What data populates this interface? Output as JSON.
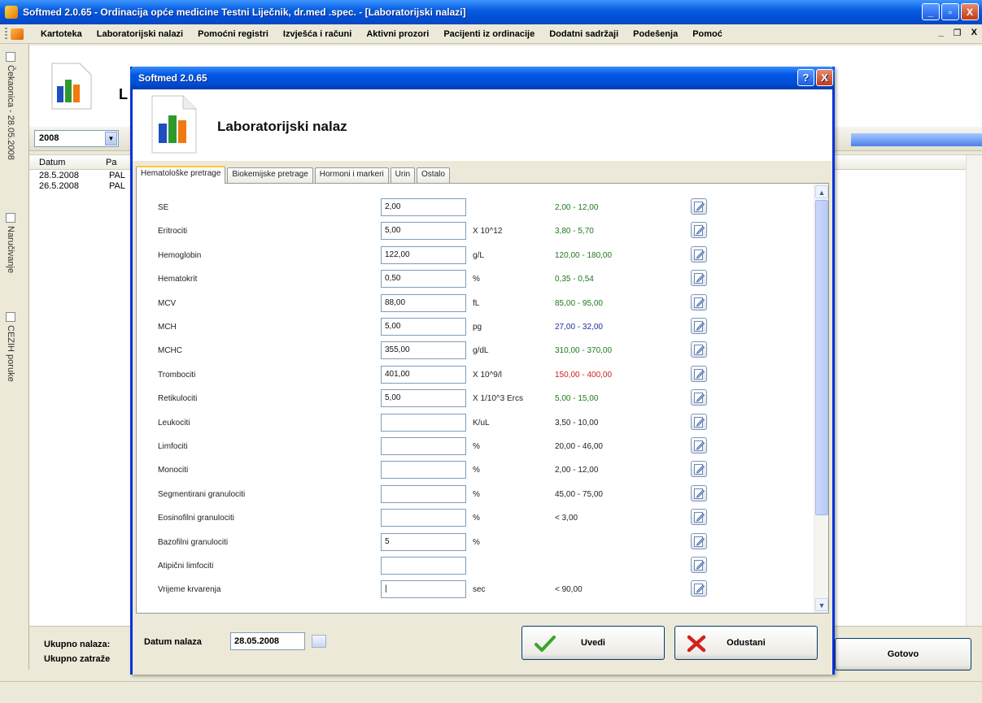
{
  "app": {
    "title": "Softmed 2.0.65 - Ordinacija opće medicine Testni Liječnik, dr.med .spec. - [Laboratorijski nalazi]",
    "window_buttons": {
      "minimize": "_",
      "maximize": "▫",
      "close": "X"
    }
  },
  "menu": {
    "items": [
      "Kartoteka",
      "Laboratorijski nalazi",
      "Pomoćni registri",
      "Izvješća i računi",
      "Aktivni prozori",
      "Pacijenti iz ordinacije",
      "Dodatni sadržaji",
      "Podešenja",
      "Pomoć"
    ],
    "mdi_buttons": {
      "minimize": "_",
      "restore": "❐",
      "close": "X"
    }
  },
  "left_strip": {
    "tabs": [
      "Čekaonica - 28.05.2008",
      "Naručivanje",
      "CEZIH poruke"
    ]
  },
  "background": {
    "header_text": "L",
    "year": "2008",
    "list_columns": [
      "Datum",
      "Pa"
    ],
    "rows": [
      {
        "datum": "28.5.2008",
        "pa": "PAL"
      },
      {
        "datum": "26.5.2008",
        "pa": "PAL"
      }
    ],
    "footer": {
      "label1": "Ukupno nalaza:",
      "label2": "Ukupno zatraže",
      "gotovo": "Gotovo"
    }
  },
  "dialog": {
    "title": "Softmed 2.0.65",
    "help_btn": "?",
    "close_btn": "X",
    "header": "Laboratorijski nalaz",
    "tabs": [
      "Hematološke pretrage",
      "Biokemijske pretrage",
      "Hormoni i markeri",
      "Urin",
      "Ostalo"
    ],
    "active_tab": 0,
    "fields": [
      {
        "label": "SE",
        "value": "2,00",
        "unit": "",
        "range": "2,00 - 12,00",
        "range_color": "#1d7a1d"
      },
      {
        "label": "Eritrociti",
        "value": "5,00",
        "unit": "X 10^12",
        "range": "3,80 - 5,70",
        "range_color": "#1d7a1d"
      },
      {
        "label": "Hemoglobin",
        "value": "122,00",
        "unit": "g/L",
        "range": "120,00 - 180,00",
        "range_color": "#1d7a1d"
      },
      {
        "label": "Hematokrit",
        "value": "0,50",
        "unit": "%",
        "range": "0,35 - 0,54",
        "range_color": "#1d7a1d"
      },
      {
        "label": "MCV",
        "value": "88,00",
        "unit": "fL",
        "range": "85,00 - 95,00",
        "range_color": "#1d7a1d"
      },
      {
        "label": "MCH",
        "value": "5,00",
        "unit": "pg",
        "range": "27,00 - 32,00",
        "range_color": "#1f2f9e"
      },
      {
        "label": "MCHC",
        "value": "355,00",
        "unit": "g/dL",
        "range": "310,00 - 370,00",
        "range_color": "#1d7a1d"
      },
      {
        "label": "Trombociti",
        "value": "401,00",
        "unit": "X 10^9/l",
        "range": "150,00 - 400,00",
        "range_color": "#d21c1c"
      },
      {
        "label": "Retikulociti",
        "value": "5,00",
        "unit": "X 1/10^3 Ercs",
        "range": "5,00 - 15,00",
        "range_color": "#1d7a1d"
      },
      {
        "label": "Leukociti",
        "value": "",
        "unit": "K/uL",
        "range": "3,50 - 10,00",
        "range_color": "#222222"
      },
      {
        "label": "Limfociti",
        "value": "",
        "unit": "%",
        "range": "20,00 - 46,00",
        "range_color": "#222222"
      },
      {
        "label": "Monociti",
        "value": "",
        "unit": "%",
        "range": "2,00 - 12,00",
        "range_color": "#222222"
      },
      {
        "label": "Segmentirani granulociti",
        "value": "",
        "unit": "%",
        "range": "45,00 - 75,00",
        "range_color": "#222222"
      },
      {
        "label": "Eosinofilni granulociti",
        "value": "",
        "unit": "%",
        "range": "< 3,00",
        "range_color": "#222222"
      },
      {
        "label": "Bazofilni granulociti",
        "value": "5",
        "unit": "%",
        "range": "",
        "range_color": "#222222"
      },
      {
        "label": "Atipični limfociti",
        "value": "",
        "unit": "",
        "range": "",
        "range_color": "#222222"
      },
      {
        "label": "Vrijeme krvarenja",
        "value": "|",
        "unit": "sec",
        "range": "< 90,00",
        "range_color": "#222222"
      }
    ],
    "footer": {
      "datum_label": "Datum nalaza",
      "datum_value": "28.05.2008",
      "uvedi": "Uvedi",
      "odustani": "Odustani"
    }
  }
}
